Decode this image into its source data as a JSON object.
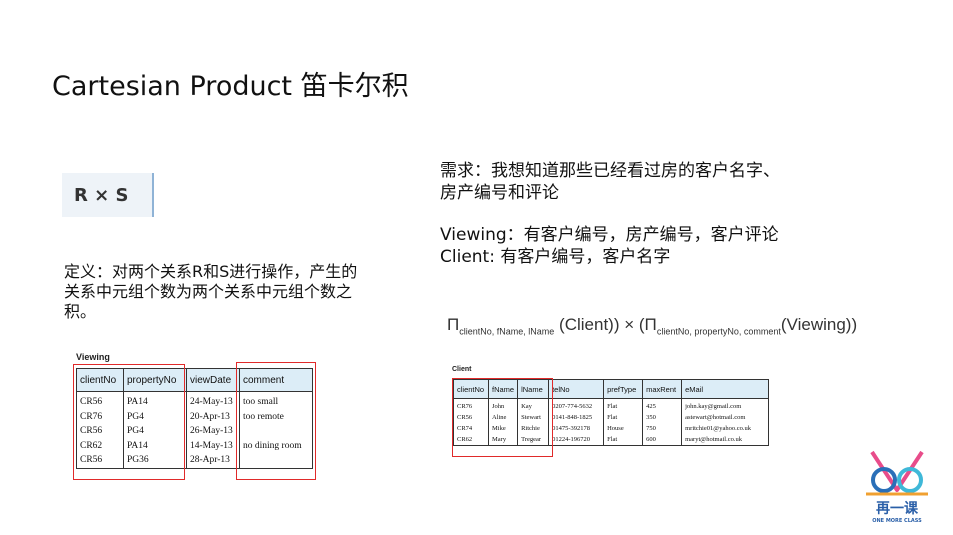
{
  "slide": {
    "title": "Cartesian Product 笛卡尔积",
    "rs_label": "R × S",
    "definition": "定义：对两个关系R和S进行操作，产生的关系中元组个数为两个关系中元组个数之积。",
    "requirement_line1": "需求：我想知道那些已经看过房的客户名字、",
    "requirement_line2": "房产编号和评论",
    "viewing_desc": "Viewing：有客户编号，房产编号，客户评论",
    "client_desc": "Client: 有客户编号，客户名字"
  },
  "formula": {
    "pi1": "Π",
    "sub1": "clientNo, fName, lName",
    "mid": " (Client)) × (",
    "pi2": "Π",
    "sub2": "clientNo, propertyNo, comment",
    "end": "(Viewing))"
  },
  "viewing_table": {
    "caption": "Viewing",
    "headers": [
      "clientNo",
      "propertyNo",
      "viewDate",
      "comment"
    ],
    "cols": [
      "CR56\nCR76\nCR56\nCR62\nCR56",
      "PA14\nPG4\nPG4\nPA14\nPG36",
      "24-May-13\n20-Apr-13\n26-May-13\n14-May-13\n28-Apr-13",
      "too small\ntoo remote\n\nno dining room\n"
    ]
  },
  "client_table": {
    "caption": "Client",
    "headers": [
      "clientNo",
      "fName",
      "lName",
      "telNo",
      "prefType",
      "maxRent",
      "eMail"
    ],
    "cols": [
      "CR76\nCR56\nCR74\nCR62",
      "John\nAline\nMike\nMary",
      "Kay\nStewart\nRitchie\nTregear",
      "0207-774-5632\n0141-848-1825\n01475-392178\n01224-196720",
      "Flat\nFlat\nHouse\nFlat",
      "425\n350\n750\n600",
      "john.kay@gmail.com\nastewart@hotmail.com\nmritchie01@yahoo.co.uk\nmaryt@hotmail.co.uk"
    ]
  },
  "logo": {
    "name": "再一课",
    "tagline": "ONE MORE CLASS",
    "colors": [
      "#e84c8a",
      "#2a6fb8",
      "#3fb8d8",
      "#f0a030"
    ]
  },
  "colors": {
    "highlight": "#e02a2a",
    "header_fill": "#dcedf7",
    "rs_fill": "#eef3f8",
    "rs_bar": "#8fb3d6"
  }
}
